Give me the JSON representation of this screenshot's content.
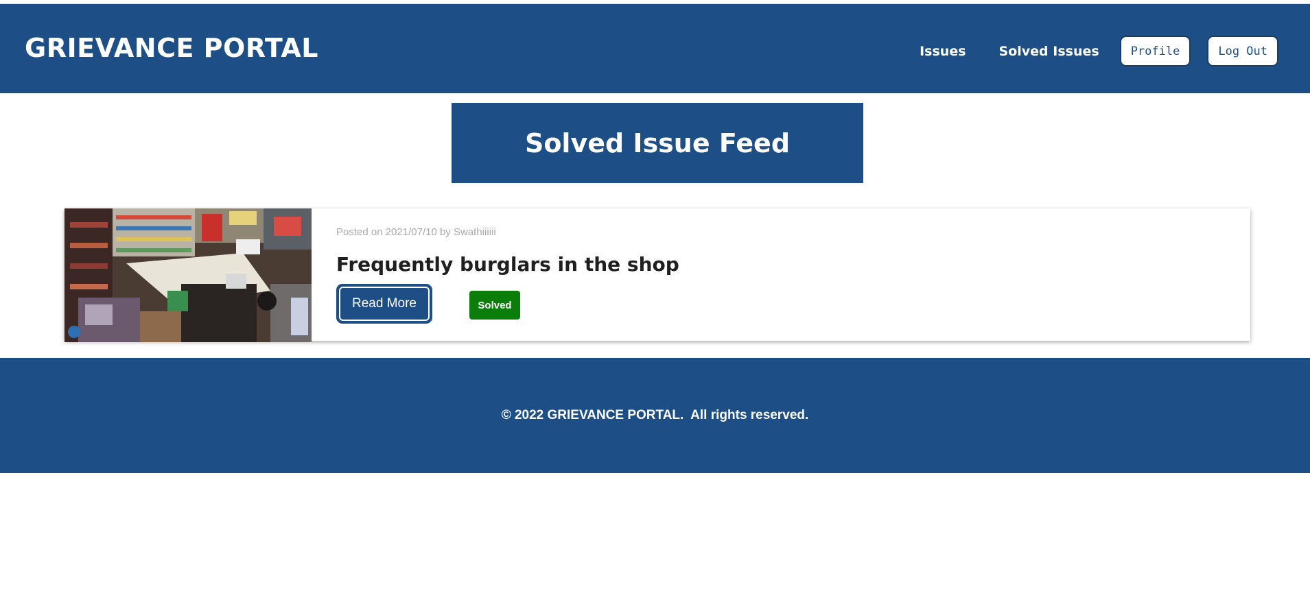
{
  "header": {
    "brand": "GRIEVANCE PORTAL",
    "nav": {
      "issues": "Issues",
      "solved_issues": "Solved Issues",
      "profile": "Profile",
      "logout": "Log Out"
    }
  },
  "feed": {
    "title": "Solved Issue Feed"
  },
  "post": {
    "meta": "Posted on 2021/07/10 by Swathiiiiii",
    "title": "Frequently burglars in the shop",
    "read_more": "Read More",
    "status": "Solved",
    "image_alt": "Shop surveillance camera view"
  },
  "footer": {
    "text": "© 2022 GRIEVANCE PORTAL.  All rights reserved."
  },
  "colors": {
    "brand_blue": "#1d4f86",
    "solved_green": "#0a7d0a",
    "meta_gray": "#a9a9a9"
  }
}
